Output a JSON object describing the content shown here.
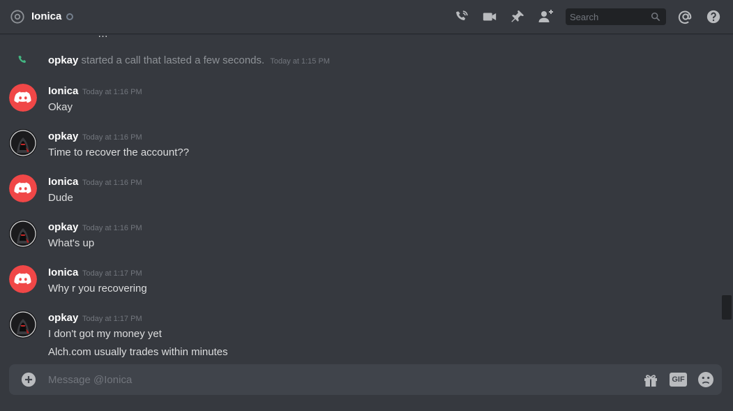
{
  "header": {
    "recipient": "Ionica",
    "search_placeholder": "Search"
  },
  "icons": {
    "at": "at-icon",
    "status": "status-circle-icon",
    "call": "phone-call-icon",
    "video": "video-camera-icon",
    "pin": "pin-icon",
    "add_friend": "add-friend-icon",
    "search": "search-icon",
    "mentions": "at-mentions-icon",
    "help": "help-icon",
    "gift": "gift-icon",
    "gif": "gif-icon",
    "emoji": "emoji-icon",
    "attach": "plus-circle-icon"
  },
  "colors": {
    "background": "#36393f",
    "brand_red": "#f04747",
    "call_green": "#43b581",
    "text_muted": "#72767d",
    "composer_bg": "#40444b"
  },
  "call_event": {
    "actor": "opkay",
    "text": "started a call that lasted a few seconds.",
    "time": "Today at 1:15 PM"
  },
  "messages": [
    {
      "author": "Ionica",
      "time": "Today at 1:16 PM",
      "lines": [
        "Okay"
      ]
    },
    {
      "author": "opkay",
      "time": "Today at 1:16 PM",
      "lines": [
        "Time to recover the account??"
      ]
    },
    {
      "author": "Ionica",
      "time": "Today at 1:16 PM",
      "lines": [
        "Dude"
      ]
    },
    {
      "author": "opkay",
      "time": "Today at 1:16 PM",
      "lines": [
        "What's up"
      ]
    },
    {
      "author": "Ionica",
      "time": "Today at 1:17 PM",
      "lines": [
        "Why r you recovering"
      ]
    },
    {
      "author": "opkay",
      "time": "Today at 1:17 PM",
      "lines": [
        "I don't got my money yet",
        "Alch.com usually trades within minutes"
      ]
    }
  ],
  "composer": {
    "placeholder": "Message @Ionica",
    "gif_label": "GIF"
  }
}
